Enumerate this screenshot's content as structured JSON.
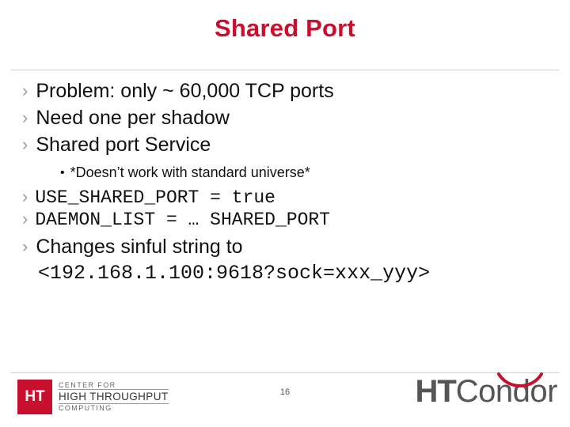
{
  "slide": {
    "title": "Shared Port",
    "page_number": "16",
    "bullet_marker": "›",
    "sub_marker": "•",
    "bullets": [
      {
        "text": "Problem:  only ~ 60,000 TCP ports",
        "level": 1,
        "mono": false
      },
      {
        "text": "Need one per shadow",
        "level": 1,
        "mono": false
      },
      {
        "text": "Shared port Service",
        "level": 1,
        "mono": false
      }
    ],
    "sub_bullet": "*Doesn’t work with standard universe*",
    "code_bullets": [
      {
        "text": "USE_SHARED_PORT = true"
      },
      {
        "text": "DAEMON_LIST = … SHARED_PORT"
      }
    ],
    "final_bullet": "Changes sinful string to",
    "final_code": "<192.168.1.100:9618?sock=xxx_yyy>"
  },
  "footer": {
    "left_logo": {
      "badge": "HT",
      "line1": "CENTER FOR",
      "line2": "HIGH THROUGHPUT",
      "line3": "COMPUTING"
    },
    "right_logo": {
      "ht": "HT",
      "condor": "Condor"
    }
  },
  "colors": {
    "title": "#c8102e",
    "text": "#111111",
    "marker": "#9a9a9a",
    "rule": "#cfcfcf",
    "logo_red": "#c8102e",
    "logo_gray": "#555555"
  }
}
